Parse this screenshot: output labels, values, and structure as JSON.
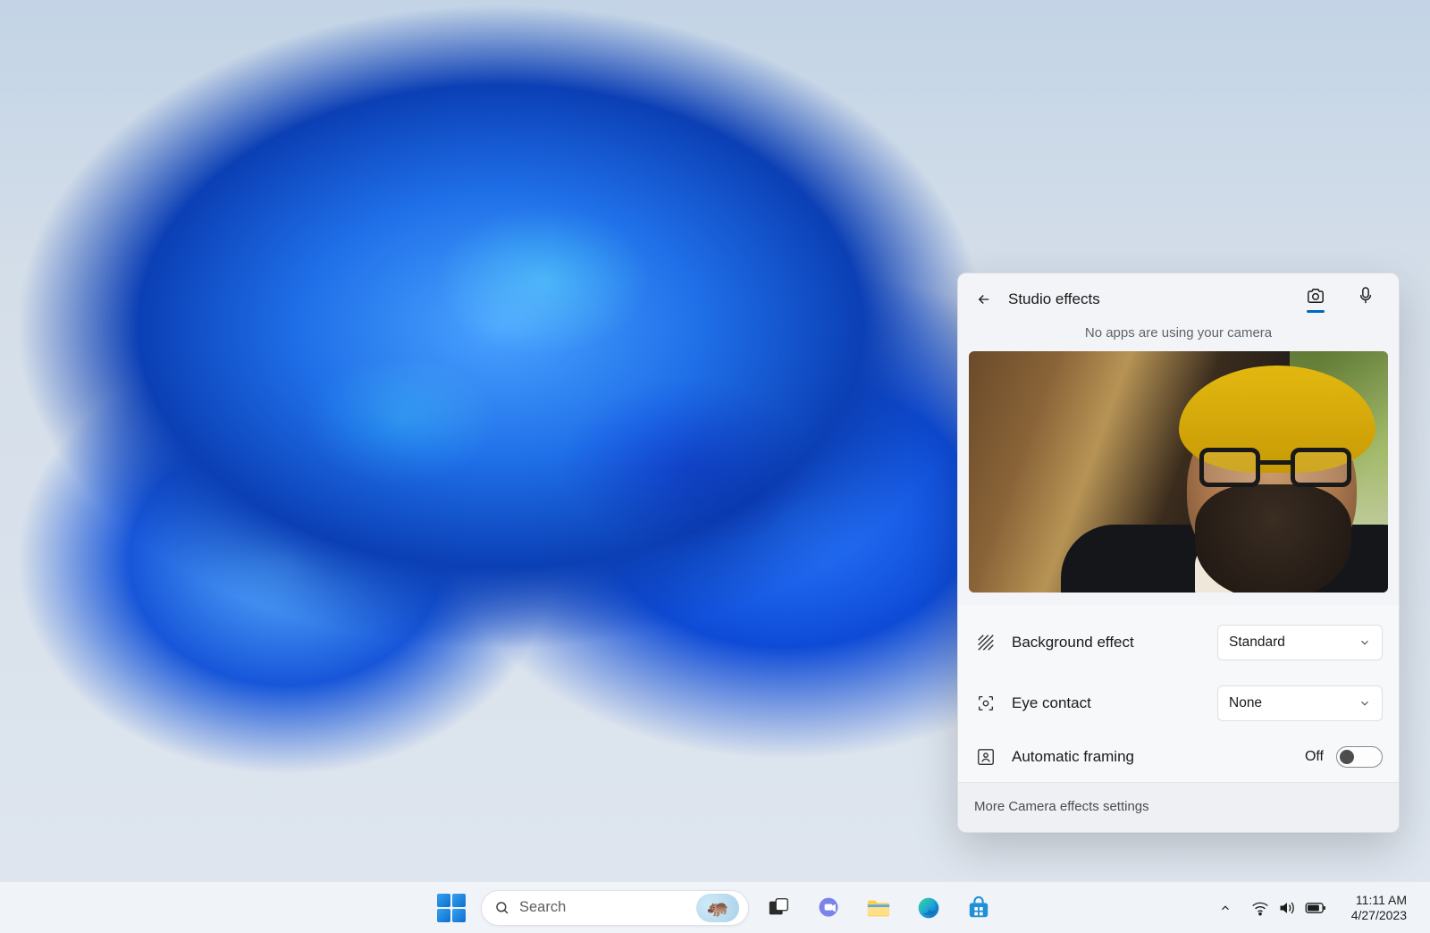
{
  "flyout": {
    "title": "Studio effects",
    "status": "No apps are using your camera",
    "tabs": {
      "camera": "camera",
      "mic": "microphone"
    },
    "rows": {
      "background": {
        "label": "Background effect",
        "value": "Standard"
      },
      "eyecontact": {
        "label": "Eye contact",
        "value": "None"
      },
      "framing": {
        "label": "Automatic framing",
        "state": "Off"
      }
    },
    "footer": "More Camera effects settings"
  },
  "taskbar": {
    "search_placeholder": "Search",
    "badge_emoji": "🦛",
    "clock": {
      "time": "11:11 AM",
      "date": "4/27/2023"
    }
  }
}
